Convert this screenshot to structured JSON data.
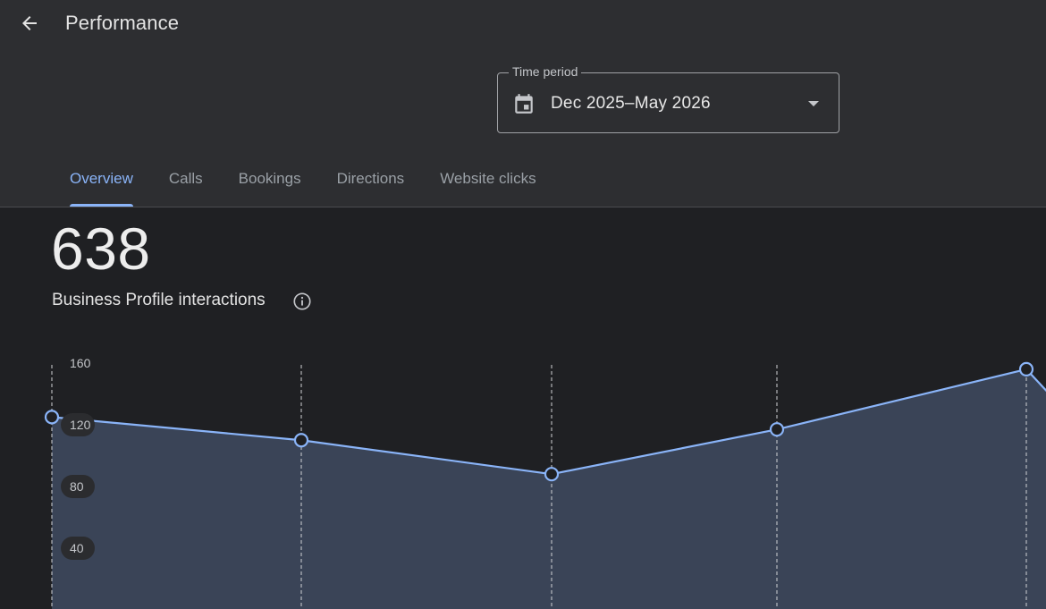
{
  "header": {
    "back_icon": "arrow-back-icon",
    "title": "Performance"
  },
  "time_period": {
    "label": "Time period",
    "value": "Dec 2025–May 2026",
    "icon": "calendar-icon"
  },
  "tabs": [
    {
      "label": "Overview",
      "active": true
    },
    {
      "label": "Calls",
      "active": false
    },
    {
      "label": "Bookings",
      "active": false
    },
    {
      "label": "Directions",
      "active": false
    },
    {
      "label": "Website clicks",
      "active": false
    }
  ],
  "metric": {
    "value": "638",
    "label": "Business Profile interactions",
    "info_icon": "info-icon"
  },
  "colors": {
    "accent": "#8ab4f8",
    "header_bg": "#2d2e31",
    "page_bg": "#1f2023",
    "area_fill": "#3a4457"
  },
  "chart_data": {
    "type": "area",
    "y_ticks": [
      160,
      120,
      80,
      40
    ],
    "ylim": [
      0,
      160
    ],
    "series": [
      {
        "values": [
          125,
          110,
          88,
          117,
          156
        ]
      }
    ],
    "x_gridlines": "dashed",
    "grid": false
  }
}
